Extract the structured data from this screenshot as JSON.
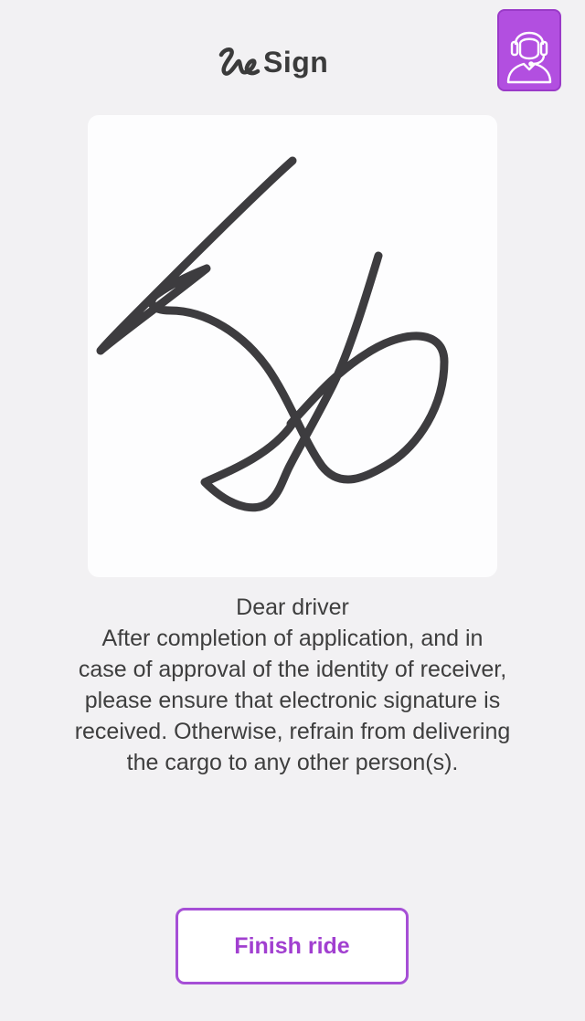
{
  "app": {
    "title": "Sign",
    "logo_icon": "signature-scribble-icon"
  },
  "support": {
    "icon": "headset-agent-icon",
    "color": "#b24fe0"
  },
  "signature_pad": {
    "background": "#fdfdfe",
    "stroke_color": "#3d3c3f"
  },
  "message": {
    "greeting": "Dear driver",
    "lines": [
      "After completion of application, and in",
      "case of approval of the identity of receiver,",
      "please ensure that electronic signature is",
      "received. Otherwise, refrain from delivering",
      "the cargo to any other person(s)."
    ]
  },
  "actions": {
    "finish_label": "Finish ride",
    "accent_color": "#a64fd6"
  }
}
